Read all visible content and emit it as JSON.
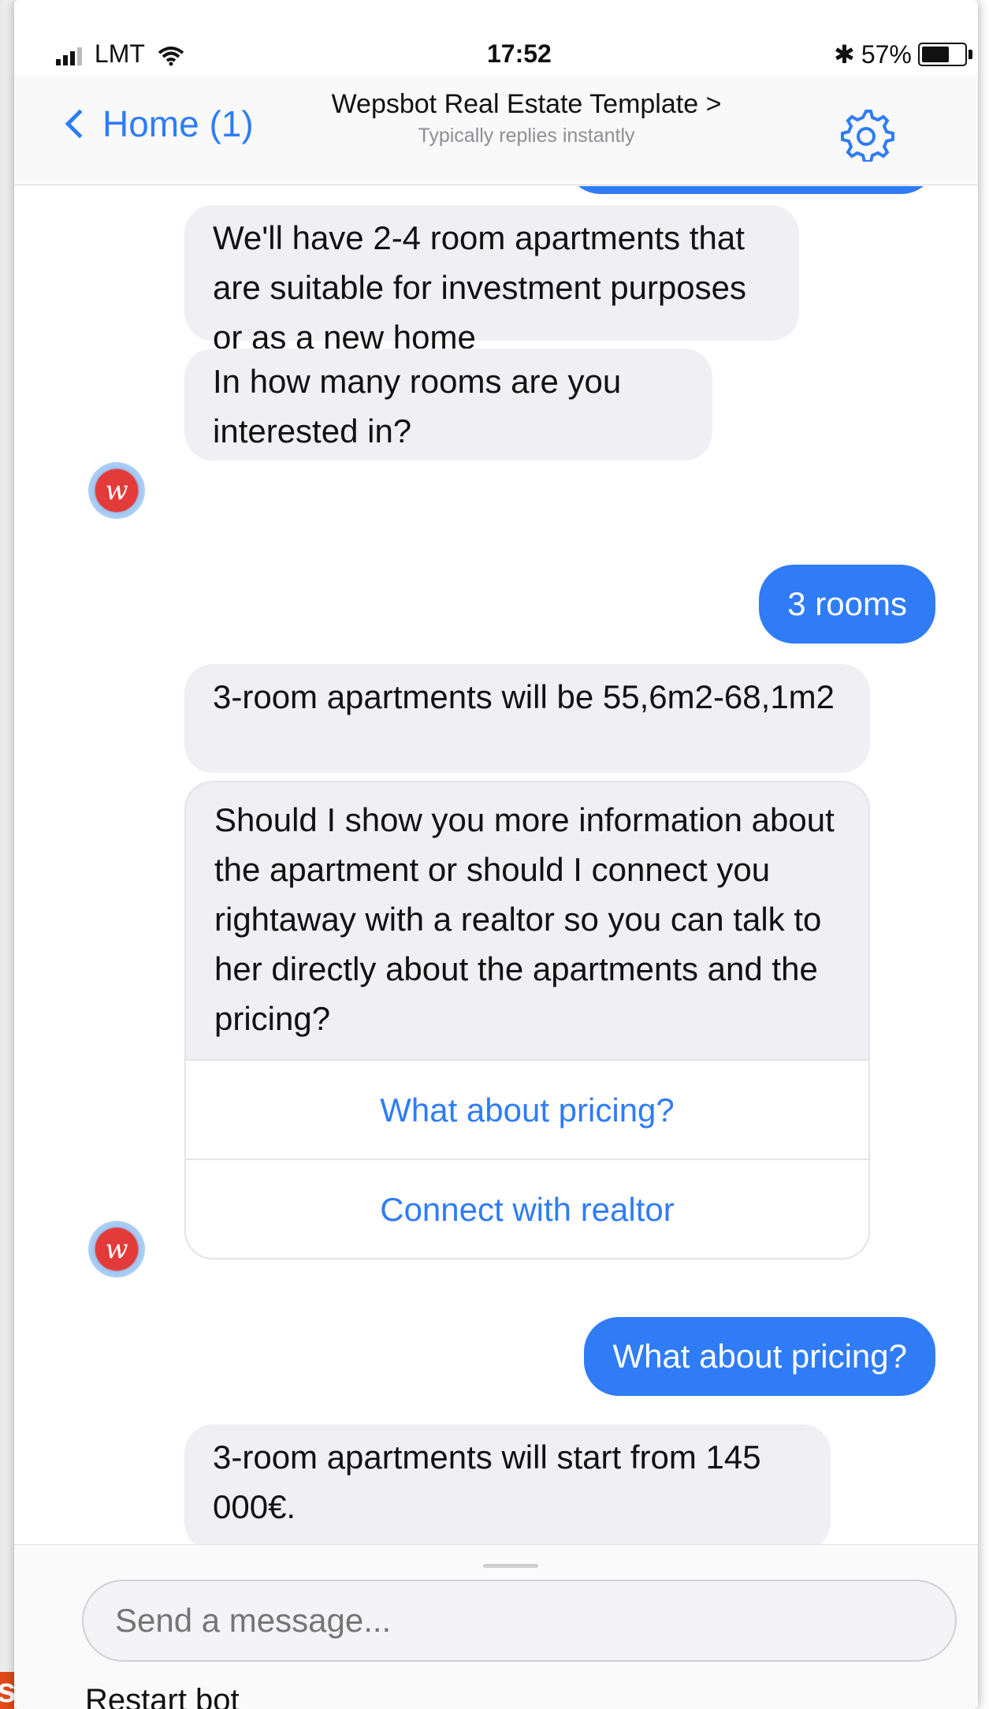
{
  "status": {
    "carrier": "LMT",
    "time": "17:52",
    "bluetooth": "✱",
    "battery": "57%"
  },
  "nav": {
    "back_label": "Home (1)",
    "title": "Wepsbot Real Estate Template >",
    "subtitle": "Typically replies instantly"
  },
  "messages": {
    "m1": "We'll have 2-4 room apartments that are suitable for investment purposes or as a new home",
    "m2": "In how many rooms are you interested in?",
    "u1": "3 rooms",
    "m3": "3-room apartments will be  55,6m2-68,1m2",
    "m4": "Should I show you more information about the apartment or should I connect you rightaway with a realtor so you can talk to her directly about the  apartments and the pricing?",
    "qr1": "What about pricing?",
    "qr2": "Connect with realtor",
    "u2": "What about pricing?",
    "m5": "3-room apartments will start from 145 000€."
  },
  "composer": {
    "placeholder": "Send a message...",
    "below_text": "Restart bot"
  },
  "colors": {
    "accent": "#2f7cf6",
    "incoming_bubble": "#efeff4",
    "outgoing_bubble": "#2f7cf6"
  },
  "icons": {
    "back": "chevron-left-icon",
    "settings": "gear-icon",
    "wifi": "wifi-icon",
    "signal": "signal-icon",
    "battery": "battery-icon",
    "avatar": "bot-avatar-icon"
  }
}
